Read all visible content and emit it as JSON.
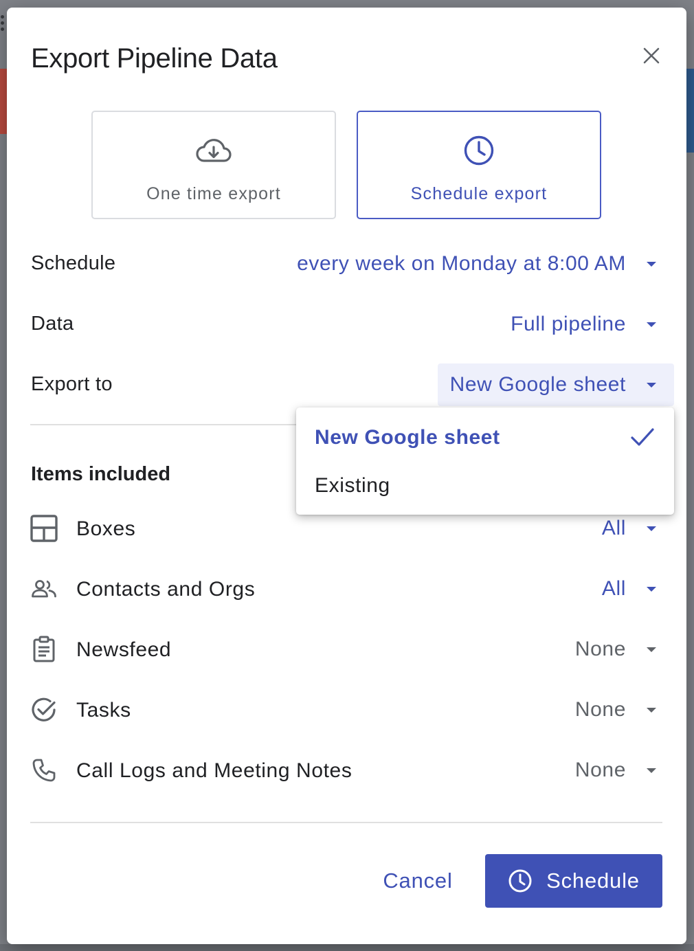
{
  "dialog": {
    "title": "Export Pipeline Data",
    "close_icon": "close-icon"
  },
  "modes": [
    {
      "label": "One time export",
      "icon": "cloud-download-icon",
      "selected": false
    },
    {
      "label": "Schedule export",
      "icon": "clock-icon",
      "selected": true
    }
  ],
  "settings": {
    "schedule": {
      "label": "Schedule",
      "value": "every week on Monday at 8:00 AM"
    },
    "data": {
      "label": "Data",
      "value": "Full pipeline"
    },
    "export_to": {
      "label": "Export to",
      "value": "New Google sheet"
    }
  },
  "export_menu": {
    "options": [
      {
        "label": "New Google sheet",
        "selected": true
      },
      {
        "label": "Existing",
        "selected": false
      }
    ]
  },
  "items": {
    "heading": "Items included",
    "rows": [
      {
        "label": "Boxes",
        "value": "All",
        "icon": "boxes-layout-icon"
      },
      {
        "label": "Contacts and Orgs",
        "value": "All",
        "icon": "people-icon"
      },
      {
        "label": "Newsfeed",
        "value": "None",
        "icon": "clipboard-icon"
      },
      {
        "label": "Tasks",
        "value": "None",
        "icon": "check-circle-icon"
      },
      {
        "label": "Call Logs and Meeting Notes",
        "value": "None",
        "icon": "phone-icon"
      }
    ]
  },
  "footer": {
    "cancel_label": "Cancel",
    "schedule_label": "Schedule"
  },
  "colors": {
    "accent": "#3f51b5",
    "muted": "#5f6368",
    "text": "#202124"
  }
}
